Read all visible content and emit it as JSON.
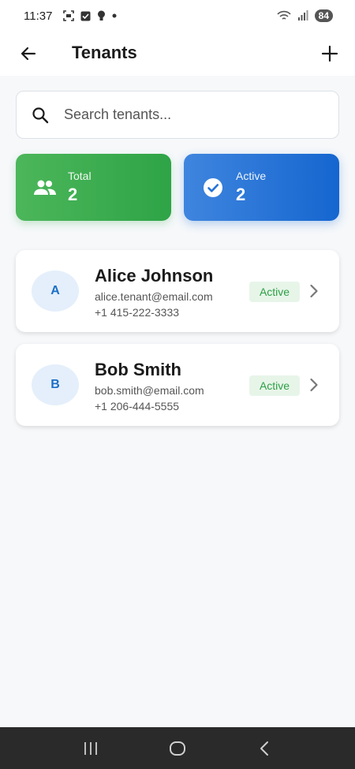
{
  "status_bar": {
    "time": "11:37",
    "battery": "84",
    "icons": [
      "screenshot-icon",
      "checkbox-icon",
      "bulb-icon",
      "dot-icon",
      "wifi-icon",
      "signal-icon",
      "battery-icon"
    ]
  },
  "app_bar": {
    "title": "Tenants",
    "back_icon": "arrow-back-icon",
    "add_icon": "plus-icon"
  },
  "search": {
    "placeholder": "Search tenants...",
    "value": ""
  },
  "stats": {
    "total": {
      "label": "Total",
      "value": "2",
      "icon": "people-icon"
    },
    "active": {
      "label": "Active",
      "value": "2",
      "icon": "check-circle-icon"
    }
  },
  "tenants": [
    {
      "initial": "A",
      "name": "Alice Johnson",
      "email": "alice.tenant@email.com",
      "phone": "+1 415-222-3333",
      "status": "Active"
    },
    {
      "initial": "B",
      "name": "Bob Smith",
      "email": "bob.smith@email.com",
      "phone": "+1 206-444-5555",
      "status": "Active"
    }
  ],
  "colors": {
    "total_card": "#3bad50",
    "active_card": "#2373d6",
    "badge_text": "#2e9f45",
    "badge_bg": "#e7f5e9",
    "avatar_bg": "#e4effb",
    "avatar_text": "#1c6fc6"
  },
  "nav": [
    "recent-apps-icon",
    "home-icon",
    "back-icon"
  ]
}
